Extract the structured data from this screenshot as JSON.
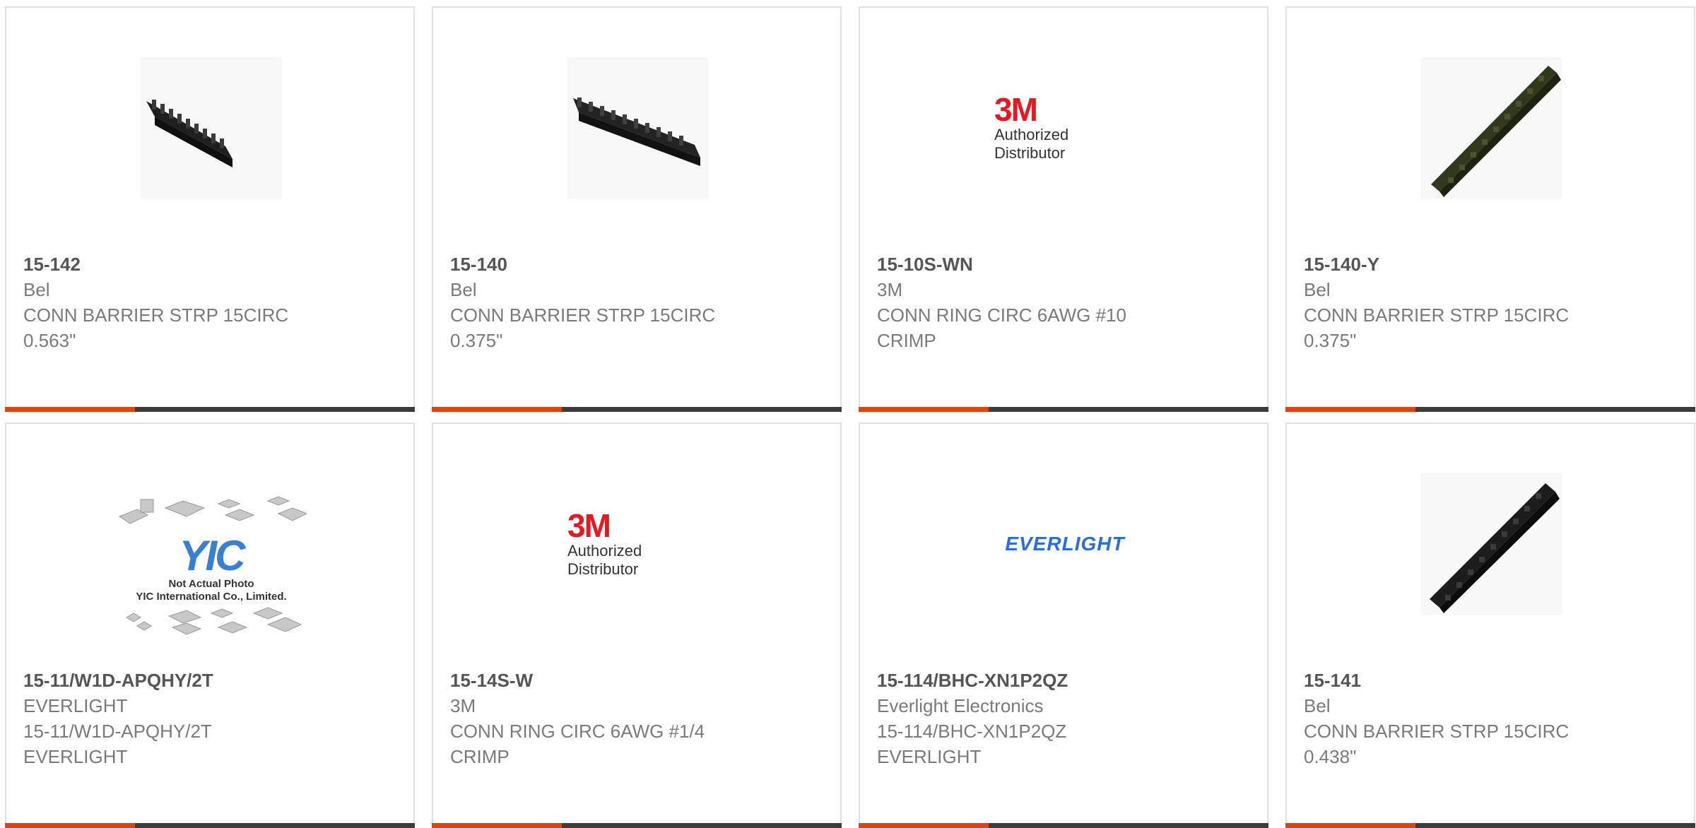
{
  "cards": [
    {
      "part": "15-142",
      "maker": "Bel",
      "desc1": "CONN BARRIER STRP 15CIRC",
      "desc2": "0.563\"",
      "image": "barrier-strip-photo"
    },
    {
      "part": "15-140",
      "maker": "Bel",
      "desc1": "CONN BARRIER STRP 15CIRC",
      "desc2": "0.375\"",
      "image": "barrier-strip-photo"
    },
    {
      "part": "15-10S-WN",
      "maker": "3M",
      "desc1": "CONN RING CIRC 6AWG #10",
      "desc2": "CRIMP",
      "image": "3m-logo",
      "logo_text": "3M",
      "logo_sub": "Authorized Distributor"
    },
    {
      "part": "15-140-Y",
      "maker": "Bel",
      "desc1": "CONN BARRIER STRP 15CIRC",
      "desc2": "0.375\"",
      "image": "barrier-strip-photo-green"
    },
    {
      "part": "15-11/W1D-APQHY/2T",
      "maker": "EVERLIGHT",
      "desc1": "15-11/W1D-APQHY/2T",
      "desc2": "EVERLIGHT",
      "image": "yic-placeholder",
      "logo_text": "YIC",
      "logo_sub1": "Not Actual Photo",
      "logo_sub2": "YIC International Co., Limited."
    },
    {
      "part": "15-14S-W",
      "maker": "3M",
      "desc1": "CONN RING CIRC 6AWG #1/4",
      "desc2": "CRIMP",
      "image": "3m-logo",
      "logo_text": "3M",
      "logo_sub": "Authorized Distributor"
    },
    {
      "part": "15-114/BHC-XN1P2QZ",
      "maker": "Everlight Electronics",
      "desc1": "15-114/BHC-XN1P2QZ",
      "desc2": "EVERLIGHT",
      "image": "everlight-logo",
      "logo_text": "EVERLIGHT"
    },
    {
      "part": "15-141",
      "maker": "Bel",
      "desc1": "CONN BARRIER STRP 15CIRC",
      "desc2": "0.438\"",
      "image": "barrier-strip-photo"
    }
  ],
  "colors": {
    "accent": "#e0440e",
    "bar": "#3c3c3c",
    "border": "#e2e2e2",
    "text": "#7a7a7a",
    "part": "#555555",
    "logo_3m": "#e01b22",
    "logo_everlight": "#2a6fd6",
    "logo_yic": "#3a7fd0"
  }
}
